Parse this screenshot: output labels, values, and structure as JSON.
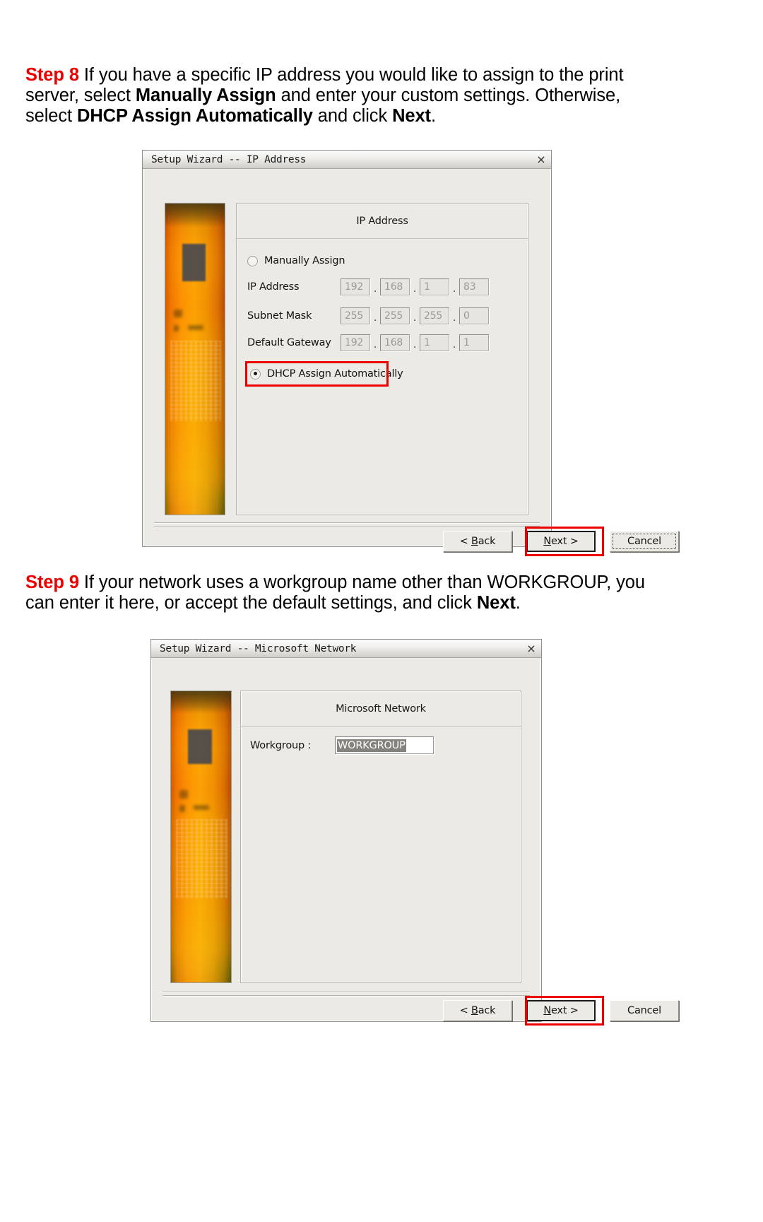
{
  "document": {
    "steps": [
      {
        "id": "step8",
        "label": "Step 8",
        "text_parts": [
          {
            "t": " If you have a specific IP address you would like to assign to the print server, select ",
            "bold": false
          },
          {
            "t": "Manually Assign",
            "bold": true
          },
          {
            "t": " and enter your custom settings.  Otherwise, select ",
            "bold": false
          },
          {
            "t": "DHCP Assign Automatically",
            "bold": true
          },
          {
            "t": " and click ",
            "bold": false
          },
          {
            "t": "Next",
            "bold": true
          },
          {
            "t": ".",
            "bold": false
          }
        ]
      },
      {
        "id": "step9",
        "label": "Step 9",
        "text_parts": [
          {
            "t": " If your network uses a workgroup name other than WORKGROUP, you can enter it here, or accept the default settings, and click ",
            "bold": false
          },
          {
            "t": "Next",
            "bold": true
          },
          {
            "t": ".",
            "bold": false
          }
        ]
      }
    ]
  },
  "dialog_ip": {
    "title": "Setup Wizard -- IP Address",
    "close_icon": "close-icon",
    "close_glyph": "×",
    "header": "IP Address",
    "radio_manual": {
      "label": "Manually Assign",
      "checked": false
    },
    "radio_dhcp": {
      "label": "DHCP Assign Automatically",
      "checked": true,
      "highlighted": true
    },
    "fields": [
      {
        "label": "IP Address",
        "octets": [
          "192",
          "168",
          "1",
          "83"
        ]
      },
      {
        "label": "Subnet Mask",
        "octets": [
          "255",
          "255",
          "255",
          "0"
        ]
      },
      {
        "label": "Default Gateway",
        "octets": [
          "192",
          "168",
          "1",
          "1"
        ]
      }
    ],
    "buttons": {
      "back": {
        "pre": "< ",
        "accel": "B",
        "post": "ack"
      },
      "next": {
        "pre": "",
        "accel": "N",
        "post": "ext >",
        "default": true,
        "highlighted": true
      },
      "cancel": {
        "pre": "",
        "accel": "",
        "post": "Cancel",
        "focus_dotted": true
      }
    }
  },
  "dialog_msnet": {
    "title": "Setup Wizard -- Microsoft Network",
    "close_icon": "close-icon",
    "close_glyph": "×",
    "header": "Microsoft Network",
    "workgroup": {
      "label": "Workgroup :",
      "value": "WORKGROUP",
      "selected": true
    },
    "buttons": {
      "back": {
        "pre": "< ",
        "accel": "B",
        "post": "ack"
      },
      "next": {
        "pre": "",
        "accel": "N",
        "post": "ext >",
        "default": true,
        "highlighted": true
      },
      "cancel": {
        "pre": "",
        "accel": "",
        "post": "Cancel"
      }
    }
  },
  "colors": {
    "step_label": "#ee0000",
    "highlight": "#ee0000",
    "dialog_face": "#eceae4",
    "text": "#141414"
  }
}
